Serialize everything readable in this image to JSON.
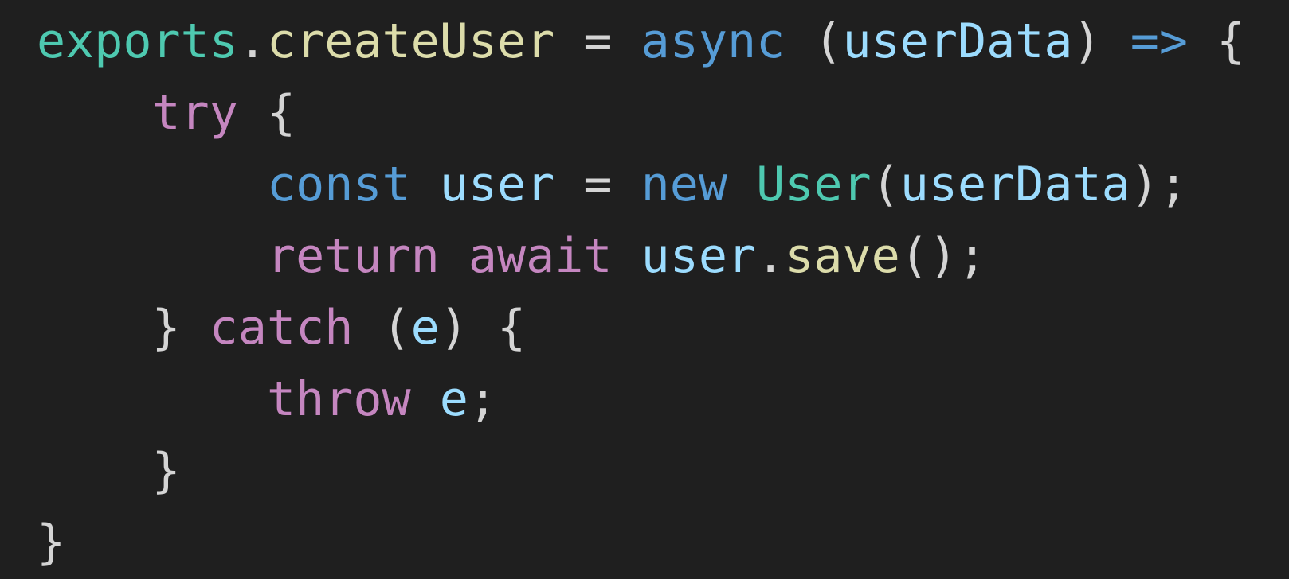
{
  "code_view": {
    "lines": [
      {
        "tokens": [
          {
            "text": "exports",
            "color": "#4ec9b0"
          },
          {
            "text": ".",
            "color": "#d4d4d4"
          },
          {
            "text": "createUser",
            "color": "#dcdcaa"
          },
          {
            "text": " = ",
            "color": "#d4d4d4"
          },
          {
            "text": "async",
            "color": "#569cd6"
          },
          {
            "text": " (",
            "color": "#d4d4d4"
          },
          {
            "text": "userData",
            "color": "#9cdcfe"
          },
          {
            "text": ") ",
            "color": "#d4d4d4"
          },
          {
            "text": "=>",
            "color": "#569cd6"
          },
          {
            "text": " {",
            "color": "#d4d4d4"
          }
        ]
      },
      {
        "tokens": [
          {
            "text": "    ",
            "color": "#d4d4d4"
          },
          {
            "text": "try",
            "color": "#c586c0"
          },
          {
            "text": " {",
            "color": "#d4d4d4"
          }
        ]
      },
      {
        "tokens": [
          {
            "text": "        ",
            "color": "#d4d4d4"
          },
          {
            "text": "const",
            "color": "#569cd6"
          },
          {
            "text": " ",
            "color": "#d4d4d4"
          },
          {
            "text": "user",
            "color": "#9cdcfe"
          },
          {
            "text": " = ",
            "color": "#d4d4d4"
          },
          {
            "text": "new",
            "color": "#569cd6"
          },
          {
            "text": " ",
            "color": "#d4d4d4"
          },
          {
            "text": "User",
            "color": "#4ec9b0"
          },
          {
            "text": "(",
            "color": "#d4d4d4"
          },
          {
            "text": "userData",
            "color": "#9cdcfe"
          },
          {
            "text": ");",
            "color": "#d4d4d4"
          }
        ]
      },
      {
        "tokens": [
          {
            "text": "        ",
            "color": "#d4d4d4"
          },
          {
            "text": "return",
            "color": "#c586c0"
          },
          {
            "text": " ",
            "color": "#d4d4d4"
          },
          {
            "text": "await",
            "color": "#c586c0"
          },
          {
            "text": " ",
            "color": "#d4d4d4"
          },
          {
            "text": "user",
            "color": "#9cdcfe"
          },
          {
            "text": ".",
            "color": "#d4d4d4"
          },
          {
            "text": "save",
            "color": "#dcdcaa"
          },
          {
            "text": "();",
            "color": "#d4d4d4"
          }
        ]
      },
      {
        "tokens": [
          {
            "text": "    ",
            "color": "#d4d4d4"
          },
          {
            "text": "}",
            "color": "#d4d4d4"
          },
          {
            "text": " ",
            "color": "#d4d4d4"
          },
          {
            "text": "catch",
            "color": "#c586c0"
          },
          {
            "text": " (",
            "color": "#d4d4d4"
          },
          {
            "text": "e",
            "color": "#9cdcfe"
          },
          {
            "text": ") {",
            "color": "#d4d4d4"
          }
        ]
      },
      {
        "tokens": [
          {
            "text": "        ",
            "color": "#d4d4d4"
          },
          {
            "text": "throw",
            "color": "#c586c0"
          },
          {
            "text": " ",
            "color": "#d4d4d4"
          },
          {
            "text": "e",
            "color": "#9cdcfe"
          },
          {
            "text": ";",
            "color": "#d4d4d4"
          }
        ]
      },
      {
        "tokens": [
          {
            "text": "    ",
            "color": "#d4d4d4"
          },
          {
            "text": "}",
            "color": "#d4d4d4"
          }
        ]
      },
      {
        "tokens": [
          {
            "text": "}",
            "color": "#d4d4d4"
          }
        ]
      }
    ]
  }
}
